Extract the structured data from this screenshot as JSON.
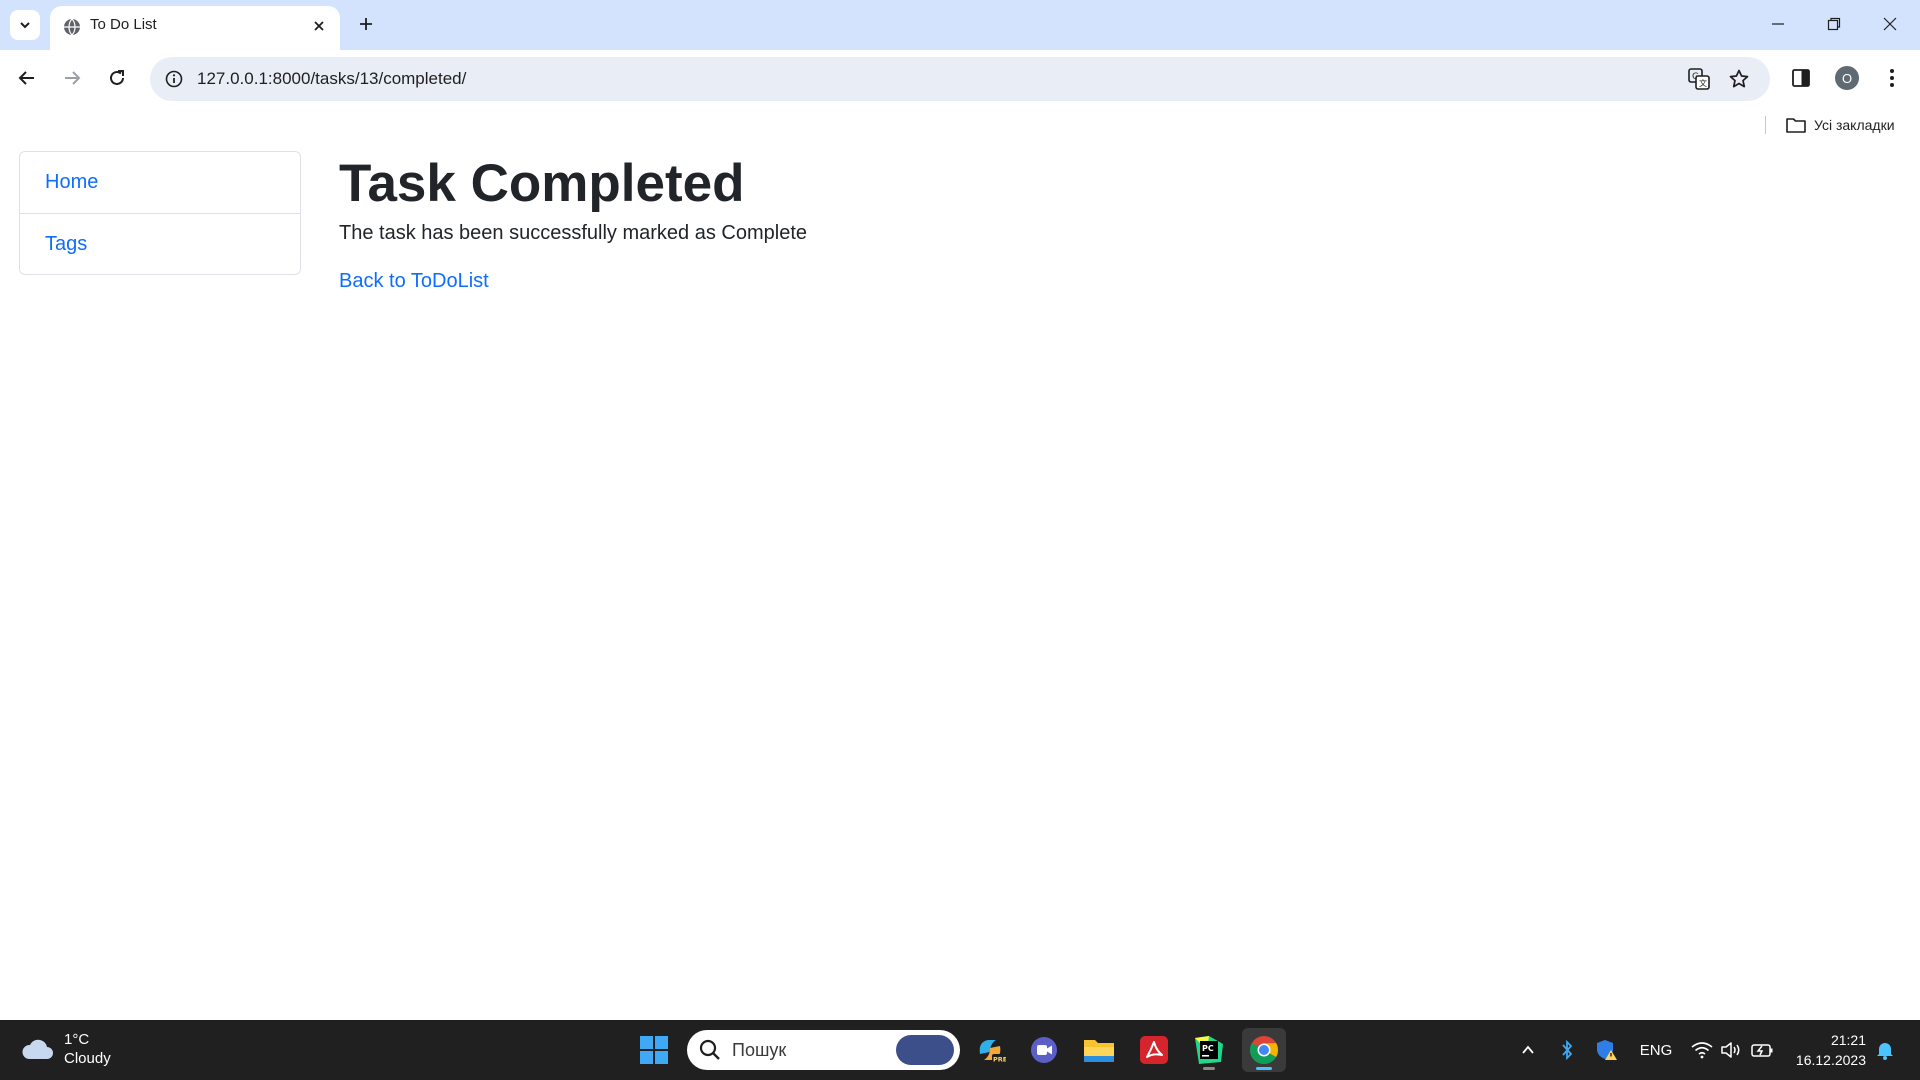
{
  "browser": {
    "tab": {
      "title": "To Do List"
    },
    "address_bar": {
      "url": "127.0.0.1:8000/tasks/13/completed/"
    },
    "profile_initial": "O",
    "bookmarks": {
      "all_bookmarks_label": "Усі закладки"
    }
  },
  "sidebar": {
    "items": [
      {
        "label": "Home"
      },
      {
        "label": "Tags"
      }
    ]
  },
  "main": {
    "title": "Task Completed",
    "message": "The task has been successfully marked as Complete",
    "back_link": "Back to ToDoList"
  },
  "taskbar": {
    "weather": {
      "temperature": "1°C",
      "condition": "Cloudy"
    },
    "search": {
      "placeholder": "Пошук"
    },
    "apps": [
      "copilot",
      "teams-meet",
      "file-explorer",
      "acrobat",
      "pycharm",
      "chrome"
    ],
    "tray": {
      "language": "ENG"
    },
    "clock": {
      "time": "21:21",
      "date": "16.12.2023"
    }
  },
  "colors": {
    "accent_link": "#0d6efd",
    "tabstrip": "#d3e3fd",
    "taskbar": "#202020"
  }
}
